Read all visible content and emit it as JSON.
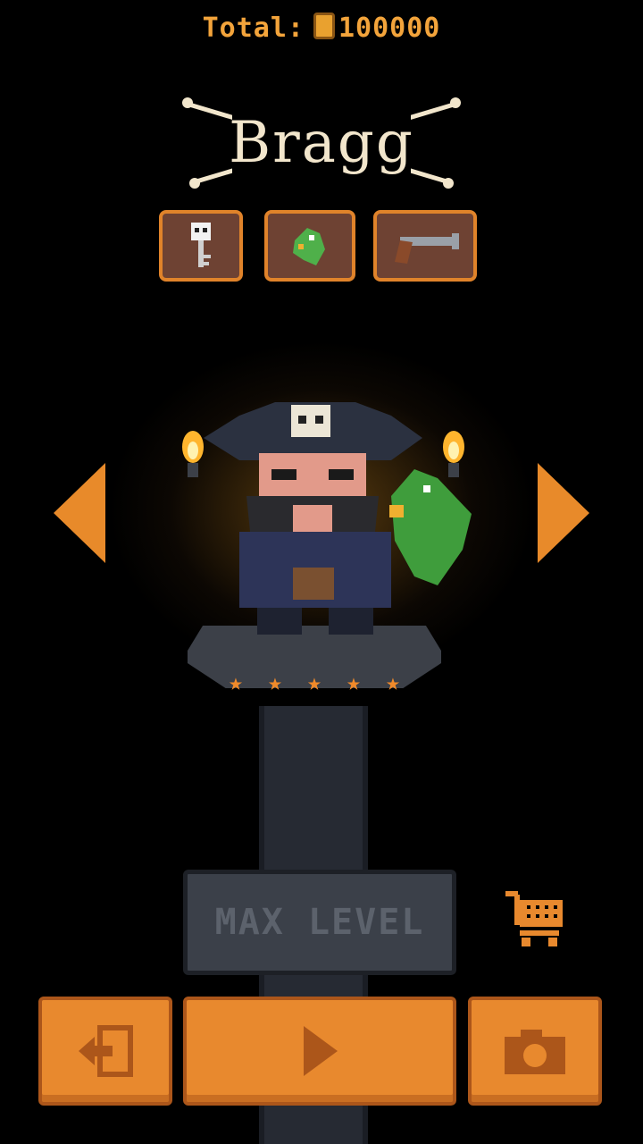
{
  "header": {
    "total_label": "Total:",
    "total_value": "100000",
    "coin_icon": "coin-icon"
  },
  "character": {
    "name": "Bragg",
    "stars": 5,
    "items": [
      {
        "name": "skull-key-icon"
      },
      {
        "name": "parrot-icon"
      },
      {
        "name": "pistol-icon"
      }
    ]
  },
  "navigation": {
    "prev": "arrow-left-icon",
    "next": "arrow-right-icon"
  },
  "upgrade": {
    "label": "MAX LEVEL"
  },
  "bottom_bar": {
    "exit": "exit-icon",
    "play": "play-icon",
    "camera": "camera-icon",
    "shop": "cart-icon"
  },
  "colors": {
    "accent": "#e8892e",
    "title": "#f2e6cc",
    "disabled": "#3b4049"
  }
}
